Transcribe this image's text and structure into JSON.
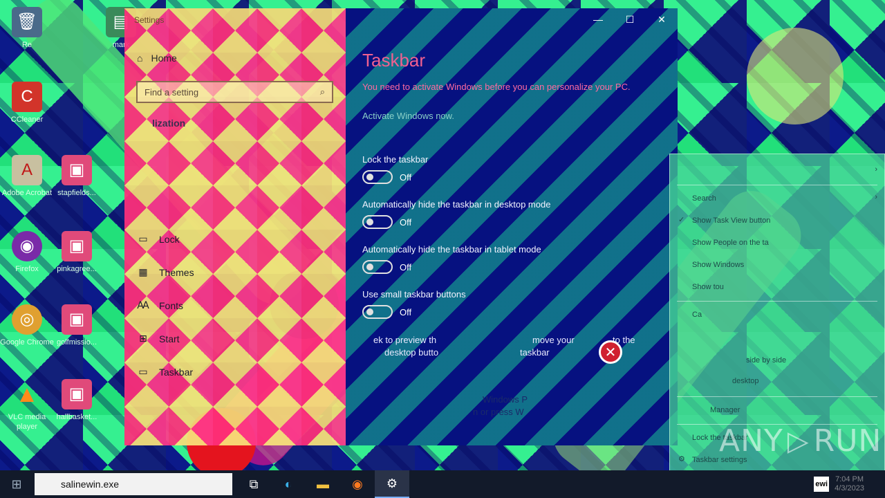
{
  "desktop": {
    "icons": [
      {
        "label": "Re",
        "icon": "recycle-bin-icon"
      },
      {
        "label": "CCleaner",
        "icon": "ccleaner-icon"
      },
      {
        "label": "Adobe Acrobat",
        "icon": "acrobat-icon"
      },
      {
        "label": "Firefox",
        "icon": "firefox-icon"
      },
      {
        "label": "Google Chrome",
        "icon": "chrome-icon"
      },
      {
        "label": "VLC media player",
        "icon": "vlc-icon"
      },
      {
        "label": "mark",
        "icon": "file-icon"
      },
      {
        "label": "stapfields...",
        "icon": "image-file-icon"
      },
      {
        "label": "pinkagree...",
        "icon": "image-file-icon"
      },
      {
        "label": "golfmissio...",
        "icon": "image-file-icon"
      },
      {
        "label": "hallbasket...",
        "icon": "image-file-icon"
      }
    ]
  },
  "settings": {
    "title": "Settings",
    "nav": {
      "home": "Home",
      "search_placeholder": "Find a setting",
      "section": "lization",
      "items": [
        {
          "label": "Lock",
          "icon": "lock-screen-icon"
        },
        {
          "label": "Themes",
          "icon": "themes-icon"
        },
        {
          "label": "Fonts",
          "icon": "fonts-icon"
        },
        {
          "label": "Start",
          "icon": "start-icon"
        },
        {
          "label": "Taskbar",
          "icon": "taskbar-icon"
        }
      ]
    },
    "content": {
      "title": "Taskbar",
      "activate_message": "You need to activate Windows before you can personalize your PC.",
      "activate_link": "Activate Windows now.",
      "settings": [
        {
          "label": "Lock the taskbar",
          "state": "Off"
        },
        {
          "label": "Automatically hide the taskbar in desktop mode",
          "state": "Off"
        },
        {
          "label": "Automatically hide the taskbar in tablet mode",
          "state": "Off"
        },
        {
          "label": "Use small taskbar buttons",
          "state": "Off"
        }
      ],
      "peek_fragment_a": "ek to preview th",
      "peek_fragment_b": "move your",
      "peek_fragment_c": "to the",
      "peek_fragment_d": "desktop butto",
      "peek_fragment_e": "taskbar",
      "replace_fragment_a": "Windows P",
      "replace_fragment_b": "n or press W"
    }
  },
  "context_menu": {
    "items": [
      {
        "label": "Search",
        "checked": false,
        "submenu": true
      },
      {
        "label": "Show Task View button",
        "checked": true,
        "submenu": false
      },
      {
        "label": "Show People on the ta",
        "checked": false,
        "submenu": false
      },
      {
        "label": "Show Windows",
        "checked": false,
        "submenu": false
      },
      {
        "label": "Show tou",
        "checked": false,
        "submenu": false
      },
      {
        "label": "Ca",
        "checked": false,
        "submenu": false
      },
      {
        "label": "side by side",
        "checked": false,
        "submenu": false
      },
      {
        "label": "desktop",
        "checked": false,
        "submenu": false
      },
      {
        "label": "Manager",
        "checked": false,
        "submenu": false
      },
      {
        "label": "Lock the taskbar",
        "checked": false,
        "submenu": false
      },
      {
        "label": "Taskbar settings",
        "checked": false,
        "submenu": false
      }
    ]
  },
  "taskbar": {
    "search_value": "salinewin.exe",
    "apps": [
      {
        "name": "task-view",
        "icon": "task-view-icon"
      },
      {
        "name": "edge",
        "icon": "edge-icon"
      },
      {
        "name": "file-explorer",
        "icon": "folder-icon"
      },
      {
        "name": "firefox",
        "icon": "firefox-icon"
      },
      {
        "name": "settings",
        "icon": "gear-icon"
      }
    ],
    "tray_app_label": "ewi",
    "clock_time": "7:04 PM",
    "clock_date": "4/3/2023"
  },
  "watermark": {
    "text": "ANY",
    "text2": "RUN"
  },
  "error_badge": "✕"
}
